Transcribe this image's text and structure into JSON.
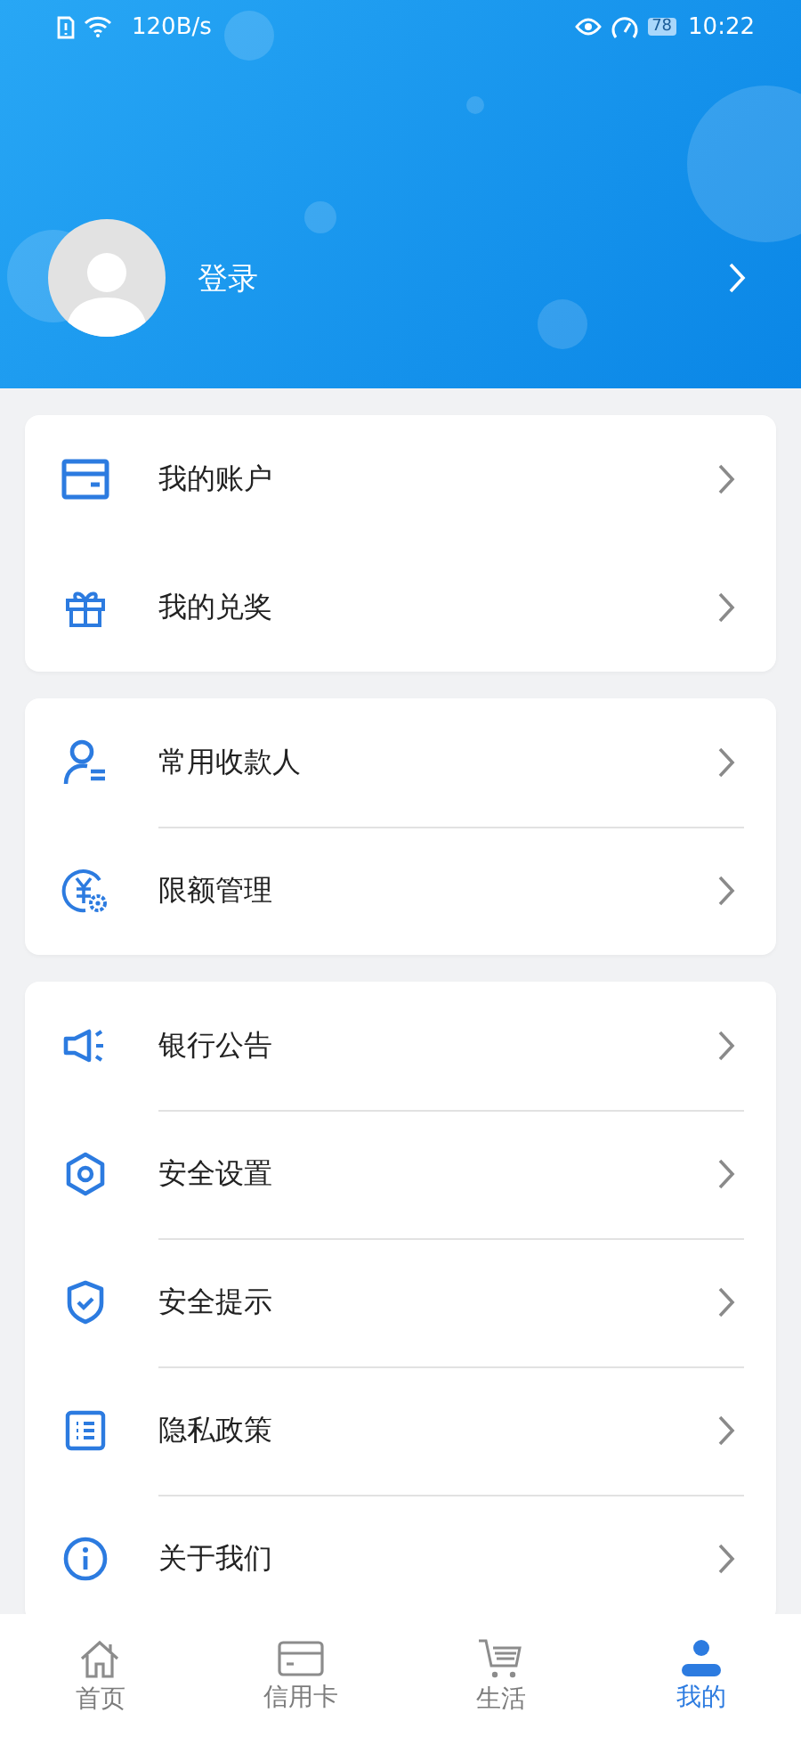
{
  "status_bar": {
    "speed": "120B/s",
    "battery": "78",
    "time": "10:22"
  },
  "profile": {
    "login": "登录"
  },
  "menu_groups": [
    {
      "dividers": false,
      "items": [
        {
          "label": "我的账户"
        },
        {
          "label": "我的兑奖"
        }
      ]
    },
    {
      "dividers": true,
      "items": [
        {
          "label": "常用收款人"
        },
        {
          "label": "限额管理"
        }
      ]
    },
    {
      "dividers": true,
      "items": [
        {
          "label": "银行公告"
        },
        {
          "label": "安全设置"
        },
        {
          "label": "安全提示"
        },
        {
          "label": "隐私政策"
        },
        {
          "label": "关于我们"
        }
      ]
    }
  ],
  "tabs": [
    {
      "label": "首页",
      "selected": false
    },
    {
      "label": "信用卡",
      "selected": false
    },
    {
      "label": "生活",
      "selected": false
    },
    {
      "label": "我的",
      "selected": true
    }
  ]
}
